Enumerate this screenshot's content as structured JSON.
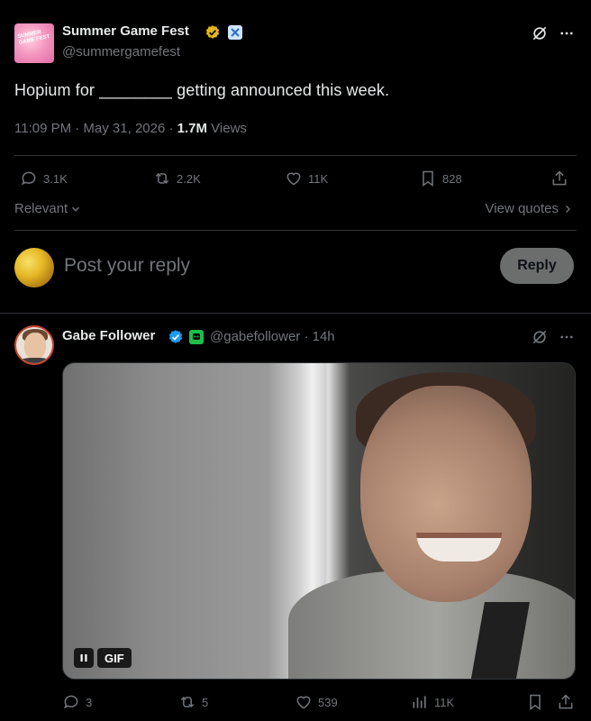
{
  "post": {
    "author_name": "Summer Game Fest",
    "author_handle": "@summergamefest",
    "avatar_text": "SUMMER GAME FEST",
    "text": "Hopium for ________ getting announced this week.",
    "time": "11:09 PM · May 31, 2026 · ",
    "views_count": "1.7M",
    "views_label": " Views",
    "stats": {
      "replies": "3.1K",
      "reposts": "2.2K",
      "likes": "11K",
      "bookmarks": "828"
    }
  },
  "sort": {
    "label": "Relevant",
    "view_quotes": "View quotes"
  },
  "compose": {
    "placeholder": "Post your reply",
    "button": "Reply"
  },
  "reply": {
    "author_name": "Gabe Follower",
    "author_handle": "@gabefollower · 14h",
    "gif_label": "GIF",
    "stats": {
      "replies": "3",
      "reposts": "5",
      "likes": "539",
      "views": "11K"
    }
  },
  "colors": {
    "background": "#000000",
    "text": "#e7e9ea",
    "muted": "#71767b",
    "divider": "#2f3336",
    "gold_check": "#e2b719",
    "blue_check": "#1d9bf0",
    "reply_button": "#787a7a"
  },
  "icons": [
    "grok-icon",
    "more-icon",
    "reply-icon",
    "repost-icon",
    "like-icon",
    "bookmark-icon",
    "share-icon",
    "chevron-down-icon",
    "chevron-right-icon",
    "verified-icon",
    "pause-icon",
    "views-icon"
  ]
}
